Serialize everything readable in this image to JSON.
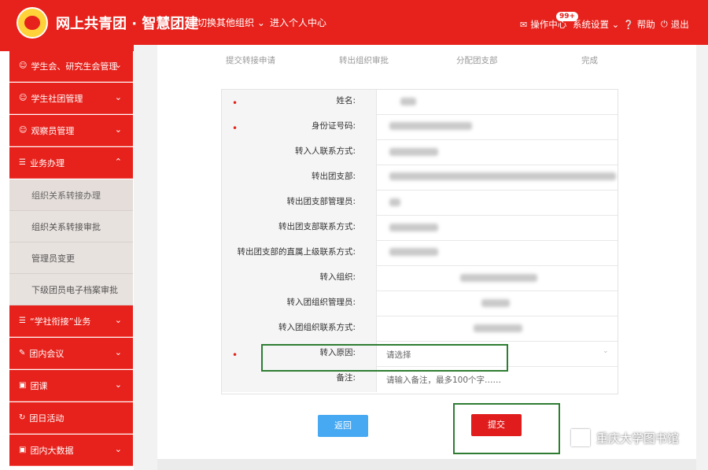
{
  "header": {
    "title": "网上共青团 · 智慧团建",
    "switch_org": "切换其他组织",
    "personal_center": "进入个人中心",
    "ops_center": "操作中心",
    "ops_badge": "99+",
    "settings": "系统设置",
    "help": "帮助",
    "logout": "退出"
  },
  "sidebar": {
    "menus": [
      {
        "label": "学生会、研究生会管理"
      },
      {
        "label": "学生社团管理"
      },
      {
        "label": "观察员管理"
      },
      {
        "label": "业务办理"
      },
      {
        "label": "“学社衔接”业务"
      },
      {
        "label": "团内会议"
      },
      {
        "label": "团课"
      },
      {
        "label": "团日活动"
      },
      {
        "label": "团内大数据"
      }
    ],
    "subs": [
      {
        "label": "组织关系转接办理"
      },
      {
        "label": "组织关系转接审批"
      },
      {
        "label": "管理员变更"
      },
      {
        "label": "下级团员电子档案审批"
      }
    ]
  },
  "steps": [
    "提交转接申请",
    "转出组织审批",
    "分配团支部",
    "完成"
  ],
  "form": {
    "required_mark": "•",
    "rows": [
      {
        "label": "姓名:"
      },
      {
        "label": "身份证号码:"
      },
      {
        "label": "转入人联系方式:"
      },
      {
        "label": "转出团支部:"
      },
      {
        "label": "转出团支部管理员:"
      },
      {
        "label": "转出团支部联系方式:"
      },
      {
        "label": "转出团支部的直属上级联系方式:"
      },
      {
        "label": "转入组织:"
      },
      {
        "label": "转入团组织管理员:"
      },
      {
        "label": "转入团组织联系方式:"
      },
      {
        "label": "转入原因:",
        "value": "请选择"
      },
      {
        "label": "备注:",
        "value": "请输入备注，最多100个字……"
      }
    ]
  },
  "buttons": {
    "back": "返回",
    "submit": "提交"
  },
  "watermark": "重庆大学图书馆",
  "colors": {
    "brand_red": "#e7211b",
    "back_blue": "#46a9f2",
    "highlight_green": "#2e7d32"
  }
}
